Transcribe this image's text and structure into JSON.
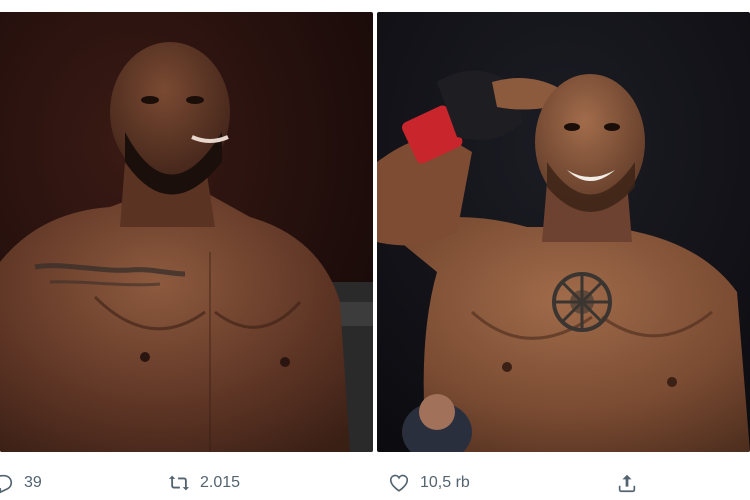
{
  "tweet": {
    "media": [
      {
        "icon": "fighter-photo-left"
      },
      {
        "icon": "fighter-photo-right"
      }
    ],
    "actions": {
      "reply_count": "39",
      "retweet_count": "2.015",
      "like_count": "10,5 rb"
    }
  },
  "colors": {
    "action_gray": "#536471",
    "skin_dark": "#5a3523",
    "skin_medium": "#8a5a3c",
    "glove_red": "#c8262c"
  }
}
